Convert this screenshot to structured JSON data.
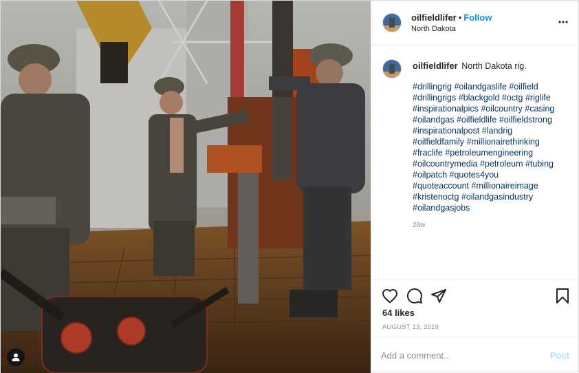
{
  "header": {
    "username": "oilfieldlifer",
    "separator": "•",
    "follow_label": "Follow",
    "location": "North Dakota",
    "more_icon": "more-horizontal-icon"
  },
  "caption": {
    "username": "oilfieldlifer",
    "text": "North Dakota rig.",
    "hashtag_lines": [
      "#drillingrig #oilandgaslife #oilfield",
      "#drillingrigs #blackgold #octg #riglife",
      "#inspirationalpics #oilcountry #casing",
      "#oilandgas #oilfieldlife #oilfieldstrong",
      "#inspirationalpost #landrig",
      "#oilfieldfamily #millionairethinking",
      "#fraclife #petroleumengineering",
      "#oilcountrymedia #petroleum #tubing",
      "#oilpatch #quotes4you",
      "#quoteaccount #millionaireimage",
      "#kristenoctg #oilandgasindustry",
      "#oilandgasjobs"
    ],
    "time_ago": "26w"
  },
  "actions": {
    "like_icon": "heart-icon",
    "comment_icon": "comment-icon",
    "share_icon": "share-icon",
    "save_icon": "bookmark-icon"
  },
  "likes": "64 likes",
  "date": "AUGUST 13, 2019",
  "add_comment": {
    "placeholder": "Add a comment...",
    "post_label": "Post"
  },
  "photo": {
    "tag_icon": "user-tag-icon"
  },
  "colors": {
    "accent": "#0095f6",
    "hashtag": "#00376b",
    "muted": "#8e8e8e",
    "post_disabled": "#b2dffc"
  }
}
